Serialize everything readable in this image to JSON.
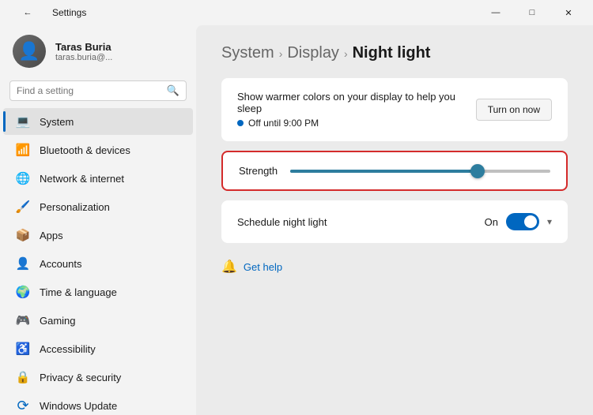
{
  "titlebar": {
    "title": "Settings",
    "back_label": "←",
    "minimize_label": "—",
    "maximize_label": "□",
    "close_label": "✕"
  },
  "user": {
    "name": "Taras Buria",
    "email": "taras.buria@..."
  },
  "search": {
    "placeholder": "Find a setting"
  },
  "nav": {
    "items": [
      {
        "id": "system",
        "label": "System",
        "icon": "💻",
        "icon_class": "blue",
        "active": true
      },
      {
        "id": "bluetooth",
        "label": "Bluetooth & devices",
        "icon": "📶",
        "icon_class": "blue"
      },
      {
        "id": "network",
        "label": "Network & internet",
        "icon": "🌐",
        "icon_class": "teal"
      },
      {
        "id": "personalization",
        "label": "Personalization",
        "icon": "🖌️",
        "icon_class": "orange"
      },
      {
        "id": "apps",
        "label": "Apps",
        "icon": "📦",
        "icon_class": "purple"
      },
      {
        "id": "accounts",
        "label": "Accounts",
        "icon": "👤",
        "icon_class": "green"
      },
      {
        "id": "time",
        "label": "Time & language",
        "icon": "🌍",
        "icon_class": "blue"
      },
      {
        "id": "gaming",
        "label": "Gaming",
        "icon": "🎮",
        "icon_class": "gray"
      },
      {
        "id": "accessibility",
        "label": "Accessibility",
        "icon": "♿",
        "icon_class": "blue"
      },
      {
        "id": "privacy",
        "label": "Privacy & security",
        "icon": "🔒",
        "icon_class": "gray"
      },
      {
        "id": "windows-update",
        "label": "Windows Update",
        "icon": "⟳",
        "icon_class": "blue"
      }
    ]
  },
  "main": {
    "breadcrumb": {
      "part1": "System",
      "part2": "Display",
      "part3": "Night light"
    },
    "night_light": {
      "description": "Show warmer colors on your display to help you sleep",
      "status": "Off until 9:00 PM",
      "turn_on_label": "Turn on now",
      "strength_label": "Strength",
      "schedule_label": "Schedule night light",
      "schedule_status": "On",
      "slider_percent": 72
    },
    "help": {
      "label": "Get help"
    }
  }
}
